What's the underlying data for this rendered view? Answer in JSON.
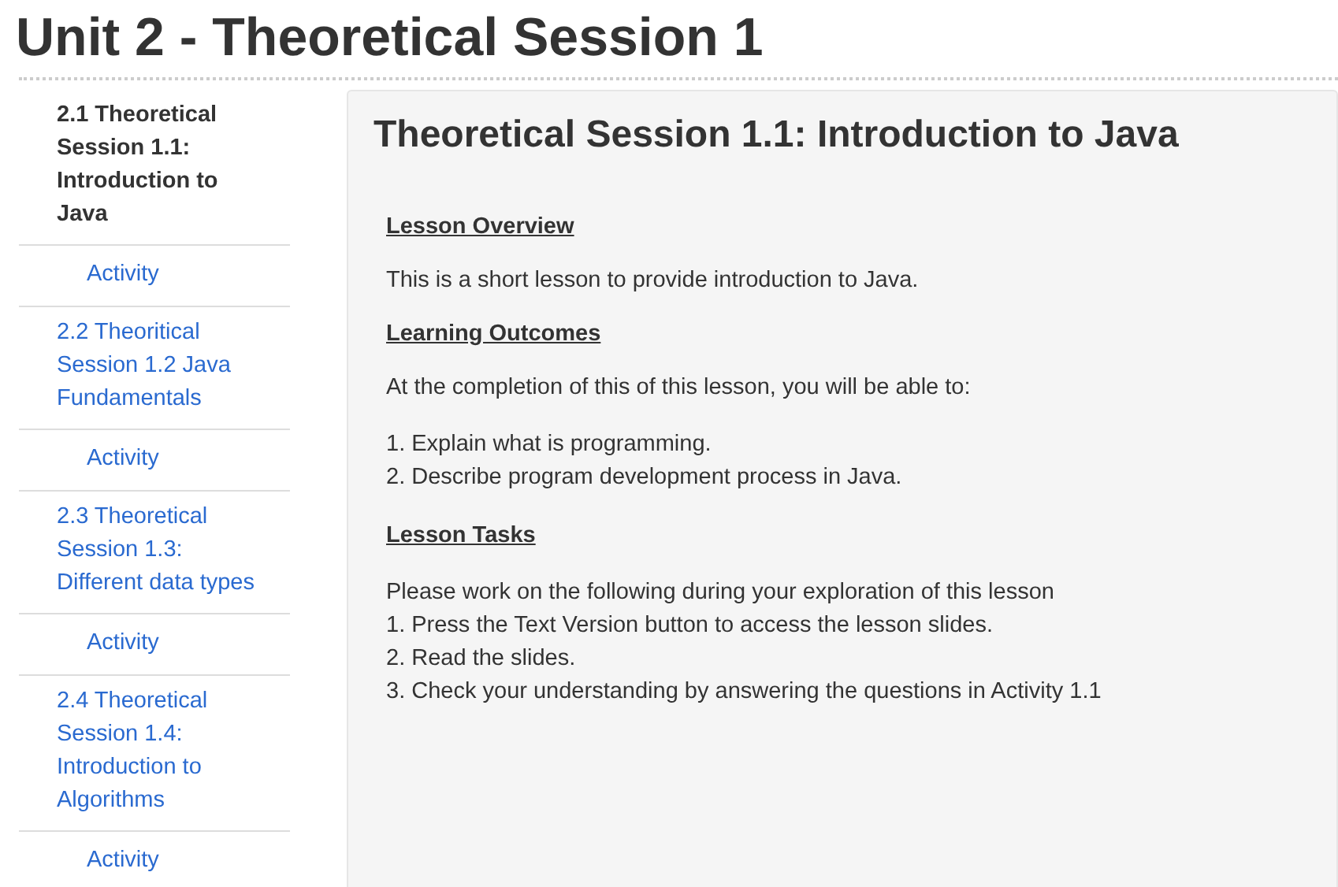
{
  "page_title": "Unit 2 - Theoretical Session 1",
  "sidebar": {
    "items": [
      {
        "label": "2.1 Theoretical Session 1.1: Introduction to Java",
        "kind": "lesson",
        "selected": true
      },
      {
        "label": "Activity",
        "kind": "activity",
        "selected": false
      },
      {
        "label": "2.2 Theoritical Session 1.2 Java Fundamentals",
        "kind": "lesson",
        "selected": false
      },
      {
        "label": "Activity",
        "kind": "activity",
        "selected": false
      },
      {
        "label": "2.3 Theoretical Session 1.3: Different data types",
        "kind": "lesson",
        "selected": false
      },
      {
        "label": "Activity",
        "kind": "activity",
        "selected": false
      },
      {
        "label": "2.4 Theoretical Session 1.4: Introduction to Algorithms",
        "kind": "lesson",
        "selected": false
      },
      {
        "label": "Activity",
        "kind": "activity",
        "selected": false
      }
    ]
  },
  "content": {
    "title": "Theoretical Session 1.1: Introduction to Java",
    "sections": [
      {
        "heading": "Lesson Overview",
        "lines": [
          "This is a short lesson to provide introduction to Java."
        ]
      },
      {
        "heading": "Learning Outcomes",
        "lines": [
          "At the completion of this of this lesson, you will be able to:"
        ],
        "list": [
          "1. Explain what is programming.",
          "2. Describe program development process in Java."
        ]
      },
      {
        "heading": "Lesson Tasks",
        "list": [
          "Please work on the following during your exploration of this lesson",
          "1. Press the Text Version button to access the lesson slides.",
          "2. Read the slides.",
          "3. Check your understanding by answering the questions in Activity 1.1"
        ]
      }
    ]
  }
}
